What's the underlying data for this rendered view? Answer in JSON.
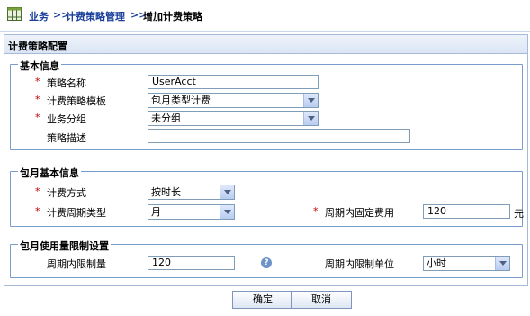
{
  "breadcrumb": {
    "root": "业务",
    "sep1": ">>",
    "item1": "计费策略管理",
    "sep2": ">>",
    "current": "增加计费策略"
  },
  "panel": {
    "title": "计费策略配置",
    "basic": {
      "legend": "基本信息",
      "required_mark": "*",
      "name_label": "策略名称",
      "name_value": "UserAcct",
      "template_label": "计费策略模板",
      "template_value": "包月类型计费",
      "group_label": "业务分组",
      "group_value": "未分组",
      "desc_label": "策略描述",
      "desc_value": ""
    },
    "monthly": {
      "legend": "包月基本信息",
      "method_label": "计费方式",
      "method_value": "按时长",
      "period_label": "计费周期类型",
      "period_value": "月",
      "fixed_fee_label": "周期内固定费用",
      "fixed_fee_value": "120",
      "fixed_fee_unit": "元"
    },
    "limit": {
      "legend": "包月使用量限制设置",
      "limit_label": "周期内限制量",
      "limit_value": "120",
      "help_icon": "?",
      "unit_label": "周期内限制单位",
      "unit_value": "小时"
    }
  },
  "buttons": {
    "ok": "确定",
    "cancel": "取消"
  },
  "colors": {
    "link": "#1a3f9a",
    "required": "#c00000",
    "border": "#7a9ccd"
  }
}
